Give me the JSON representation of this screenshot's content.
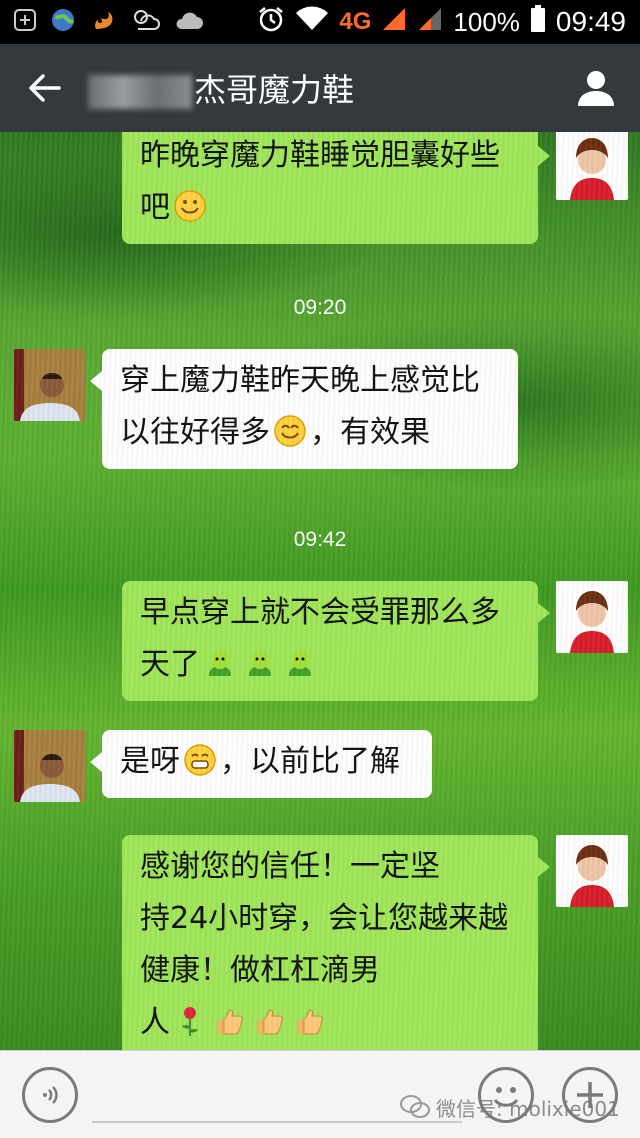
{
  "status_bar": {
    "network": "4G",
    "battery": "100%",
    "time": "09:49"
  },
  "header": {
    "title": "杰哥魔力鞋"
  },
  "messages": [
    {
      "side": "right",
      "text": [
        "昨晚穿魔力鞋睡觉胆囊好些",
        "吧"
      ],
      "emojis": [
        "smile-emoji"
      ]
    },
    {
      "timestamp": "09:20"
    },
    {
      "side": "left",
      "text": [
        "穿上魔力鞋昨天晚上感觉比",
        "以往好得多",
        "，有效果"
      ],
      "emojis": [
        "smile-emoji"
      ]
    },
    {
      "timestamp": "09:42"
    },
    {
      "side": "right",
      "text": [
        "早点穿上就不会受罪那么多",
        "天了"
      ],
      "emojis": [
        "sprout-emoji",
        "sprout-emoji",
        "sprout-emoji"
      ]
    },
    {
      "side": "left",
      "text": [
        "是呀",
        "，以前比了解"
      ],
      "emojis": [
        "grin-emoji"
      ]
    },
    {
      "side": "right",
      "text": [
        "感谢您的信任！一定坚",
        "持24小时穿，会让您越来越",
        "健康！做杠杠滴男",
        "人"
      ],
      "emojis": [
        "rose-emoji",
        "thumbs-up-emoji",
        "thumbs-up-emoji",
        "thumbs-up-emoji"
      ]
    }
  ],
  "watermark": "微信号: molixie001",
  "colors": {
    "header_bg": "#34393d",
    "bubble_sent": "#a0e75a",
    "bubble_received": "#ffffff",
    "status_4g": "#ff6a2a"
  }
}
